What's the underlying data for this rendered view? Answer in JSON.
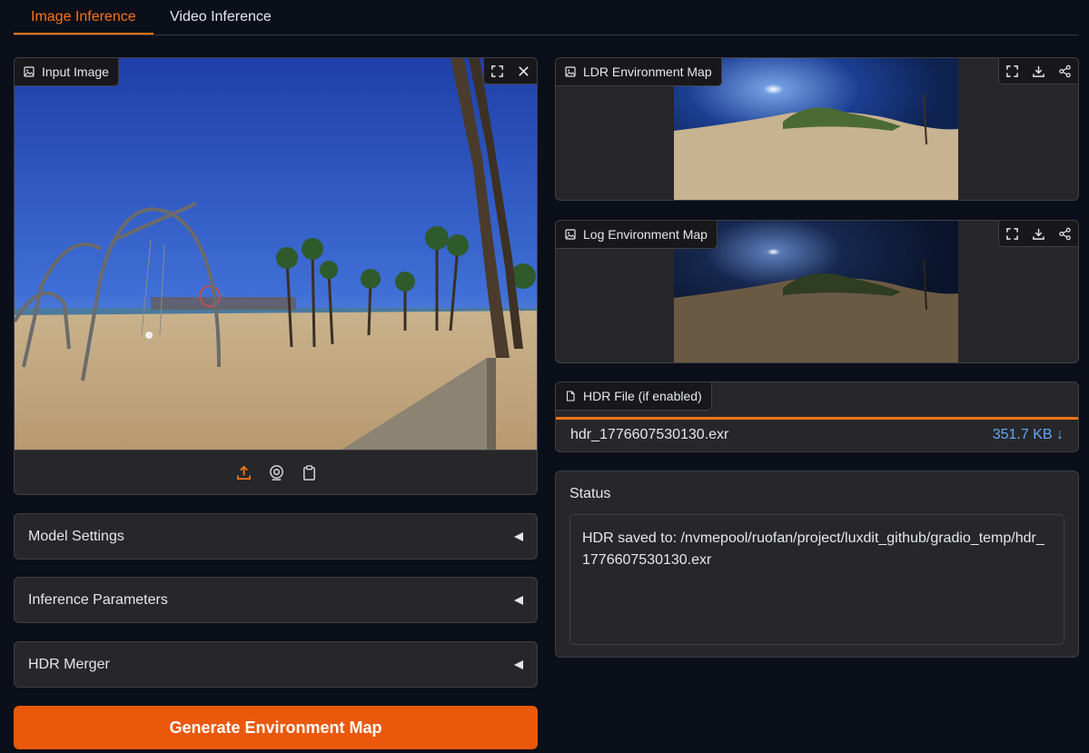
{
  "tabs": [
    {
      "label": "Image Inference",
      "active": true
    },
    {
      "label": "Video Inference",
      "active": false
    }
  ],
  "input_image": {
    "label": "Input Image",
    "header_icons": [
      "fullscreen-icon",
      "close-icon"
    ],
    "toolbar_icons": [
      "upload-icon",
      "webcam-icon",
      "clipboard-icon"
    ]
  },
  "ldr_map": {
    "label": "LDR Environment Map",
    "header_icons": [
      "fullscreen-icon",
      "download-icon",
      "share-icon"
    ]
  },
  "log_map": {
    "label": "Log Environment Map",
    "header_icons": [
      "fullscreen-icon",
      "download-icon",
      "share-icon"
    ]
  },
  "hdr_file": {
    "label": "HDR File (if enabled)",
    "filename": "hdr_1776607530130.exr",
    "size": "351.7 KB ↓"
  },
  "accordions": [
    {
      "label": "Model Settings"
    },
    {
      "label": "Inference Parameters"
    },
    {
      "label": "HDR Merger"
    }
  ],
  "generate_button": {
    "label": "Generate Environment Map"
  },
  "status": {
    "label": "Status",
    "text": "HDR saved to: /nvmepool/ruofan/project/luxdit_github/gradio_temp/hdr_1776607530130.exr"
  },
  "colors": {
    "accent": "#f97316",
    "button": "#ea580c",
    "background": "#0b0f19",
    "panel": "#27272a",
    "link": "#60a5fa"
  }
}
